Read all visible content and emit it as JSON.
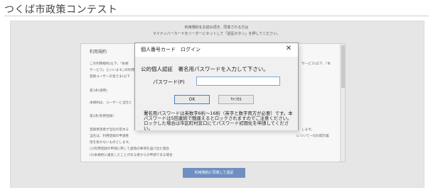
{
  "page": {
    "title": "つくば市政策コンテスト",
    "instructions": [
      "利用規約をお読み頂き、同意される方は",
      "マイナンバーカードをリーダーにセットして「認証ボタン」を押してください。"
    ]
  },
  "terms": {
    "heading": "利用規約",
    "lines": [
      "この利用規約(以下、「本規",
      "サービス」といいます。)の利用",
      "登録ユーザーの皆さま(以下",
      "第1条(適用)",
      "本規約は、ユーザーと当社と",
      "第2条(利用登録)",
      "登録希望者が当社の定める",
      "当社は、利用登録の申請者",
      "悟を負わないものとします。",
      "(1)利用登録の申請に際して虚偽の事項を届け出た場合",
      "(2)本規約に違反したことがある者からの申請である場合"
    ],
    "right_lines": [
      "サービス(以下、「本",
      "します。",
      "について一切の開示義"
    ],
    "agree_button_label": "利用規約に同意して認証"
  },
  "modal": {
    "title": "個人番号カード　ログイン",
    "close_glyph": "✕",
    "prompt": "公的個人認証　署名用パスワードを入力して下さい。",
    "password_label": "パスワード(P)",
    "password_value": "",
    "ok_label": "OK",
    "cancel_label": "ｷｬﾝｾﾙ",
    "note": "署名用パスワードは英数字6桁〜16桁（英字と数字両方が必要）です。本パスワードは5回連続で間違えるとロックされますのでご注意ください。ロックした場合は市区町村窓口にてパスワード初期化を申請してください。"
  },
  "colors": {
    "accent_button": "#6f8fc2",
    "input_border": "#7aa7d8",
    "panel_bg": "#e6e6e6"
  }
}
